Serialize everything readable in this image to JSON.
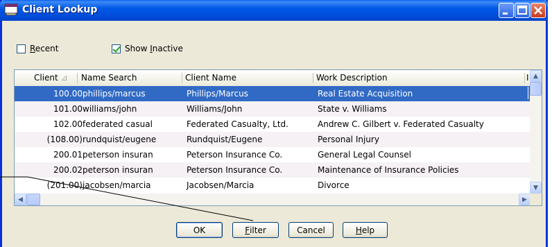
{
  "window": {
    "title": "Client Lookup"
  },
  "options": {
    "recent": {
      "label_underlined": "R",
      "label_rest": "ecent",
      "checked": false
    },
    "show_inactive": {
      "label_pre": "Show ",
      "label_underlined": "I",
      "label_rest": "nactive",
      "checked": true
    }
  },
  "list": {
    "columns": [
      "Client",
      "Name Search",
      "Client Name",
      "Work Description",
      "I"
    ],
    "rows": [
      {
        "client": "100.00",
        "search": "phillips/marcus",
        "name": "Phillips/Marcus",
        "work": "Real Estate Acquisition",
        "selected": true
      },
      {
        "client": "101.00",
        "search": "williams/john",
        "name": "Williams/John",
        "work": "State v. Williams"
      },
      {
        "client": "102.00",
        "search": "federated casual",
        "name": "Federated Casualty, Ltd.",
        "work": "Andrew C. Gilbert v. Federated Casualty"
      },
      {
        "client": "(108.00)",
        "search": "rundquist/eugene",
        "name": "Rundquist/Eugene",
        "work": "Personal Injury"
      },
      {
        "client": "200.01",
        "search": "peterson insuran",
        "name": "Peterson Insurance Co.",
        "work": "General Legal Counsel"
      },
      {
        "client": "200.02",
        "search": "peterson insuran",
        "name": "Peterson Insurance Co.",
        "work": "Maintenance of Insurance Policies"
      },
      {
        "client": "(201.00)",
        "search": "jacobsen/marcia",
        "name": "Jacobsen/Marcia",
        "work": "Divorce"
      }
    ]
  },
  "buttons": {
    "ok": "OK",
    "filter_u": "F",
    "filter_rest": "ilter",
    "cancel": "Cancel",
    "help_u": "H",
    "help_rest": "elp"
  },
  "colors": {
    "selection": "#316ac5",
    "titlebar": "#0058e6",
    "dialog": "#ece9d8"
  }
}
